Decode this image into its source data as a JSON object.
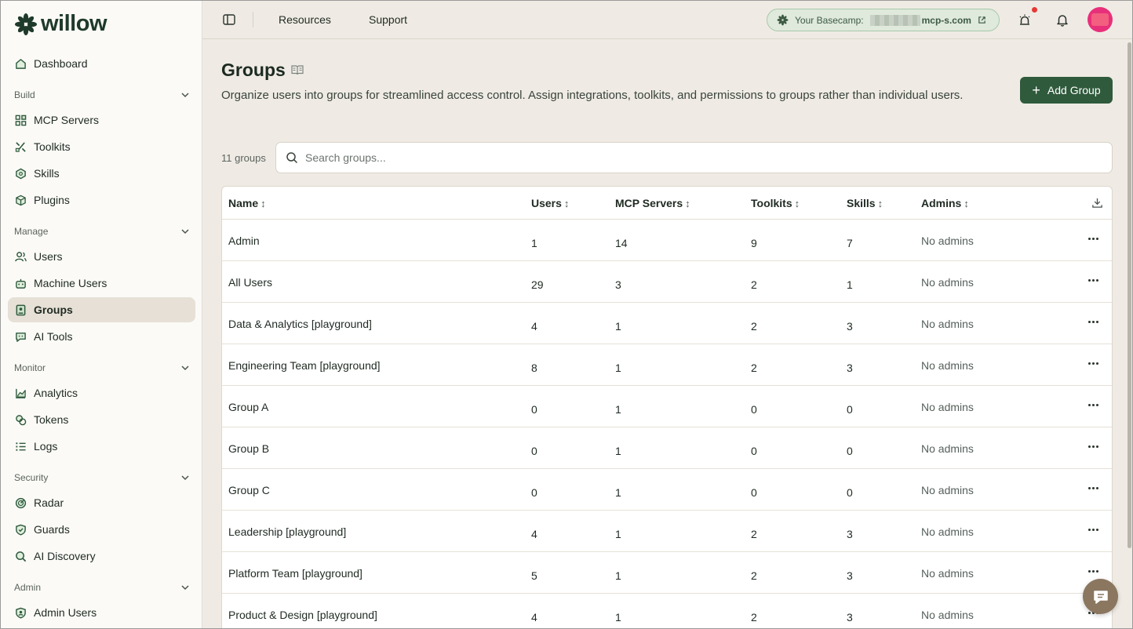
{
  "brand": {
    "name": "willow",
    "accent": "#2f5a3c"
  },
  "sidebar": {
    "dashboard": "Dashboard",
    "sections": {
      "build": {
        "label": "Build",
        "items": [
          "MCP Servers",
          "Toolkits",
          "Skills",
          "Plugins"
        ]
      },
      "manage": {
        "label": "Manage",
        "items": [
          "Users",
          "Machine Users",
          "Groups",
          "AI Tools"
        ]
      },
      "monitor": {
        "label": "Monitor",
        "items": [
          "Analytics",
          "Tokens",
          "Logs"
        ]
      },
      "security": {
        "label": "Security",
        "items": [
          "Radar",
          "Guards",
          "AI Discovery"
        ]
      },
      "admin": {
        "label": "Admin",
        "items": [
          "Admin Users"
        ]
      }
    },
    "active": "Groups"
  },
  "topbar": {
    "links": [
      "Resources",
      "Support"
    ],
    "basecamp_label": "Your Basecamp:",
    "basecamp_domain": "mcp-s.com"
  },
  "page": {
    "title": "Groups",
    "description": "Organize users into groups for streamlined access control. Assign integrations, toolkits, and permissions to groups rather than individual users.",
    "add_button": "Add Group",
    "count_label": "11 groups",
    "search_placeholder": "Search groups..."
  },
  "table": {
    "columns": [
      "Name",
      "Users",
      "MCP Servers",
      "Toolkits",
      "Skills",
      "Admins"
    ],
    "rows": [
      {
        "name": "Admin",
        "users": "1",
        "mcp": "14",
        "toolkits": "9",
        "skills": "7",
        "admins": "No admins"
      },
      {
        "name": "All Users",
        "users": "29",
        "mcp": "3",
        "toolkits": "2",
        "skills": "1",
        "admins": "No admins"
      },
      {
        "name": "Data & Analytics [playground]",
        "users": "4",
        "mcp": "1",
        "toolkits": "2",
        "skills": "3",
        "admins": "No admins"
      },
      {
        "name": "Engineering Team [playground]",
        "users": "8",
        "mcp": "1",
        "toolkits": "2",
        "skills": "3",
        "admins": "No admins"
      },
      {
        "name": "Group A",
        "users": "0",
        "mcp": "1",
        "toolkits": "0",
        "skills": "0",
        "admins": "No admins"
      },
      {
        "name": "Group B",
        "users": "0",
        "mcp": "1",
        "toolkits": "0",
        "skills": "0",
        "admins": "No admins"
      },
      {
        "name": "Group C",
        "users": "0",
        "mcp": "1",
        "toolkits": "0",
        "skills": "0",
        "admins": "No admins"
      },
      {
        "name": "Leadership [playground]",
        "users": "4",
        "mcp": "1",
        "toolkits": "2",
        "skills": "3",
        "admins": "No admins"
      },
      {
        "name": "Platform Team [playground]",
        "users": "5",
        "mcp": "1",
        "toolkits": "2",
        "skills": "3",
        "admins": "No admins"
      },
      {
        "name": "Product & Design [playground]",
        "users": "4",
        "mcp": "1",
        "toolkits": "2",
        "skills": "3",
        "admins": "No admins"
      }
    ]
  }
}
